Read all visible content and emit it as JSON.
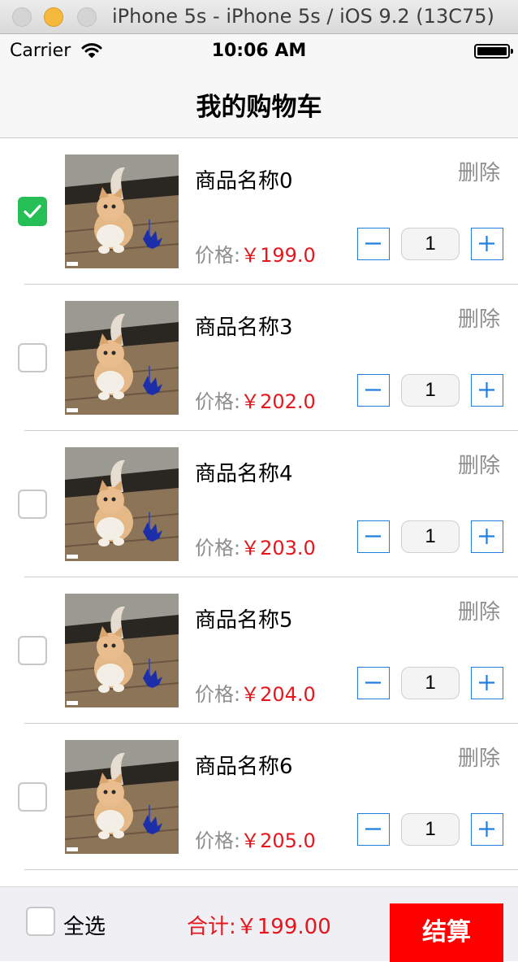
{
  "window": {
    "title": "iPhone 5s - iPhone 5s / iOS 9.2 (13C75)"
  },
  "status_bar": {
    "carrier": "Carrier",
    "time": "10:06 AM"
  },
  "nav": {
    "title": "我的购物车"
  },
  "cart": {
    "delete_label": "删除",
    "price_label": "价格:",
    "items": [
      {
        "name": "商品名称0",
        "price": "￥199.0",
        "quantity": "1",
        "checked": true
      },
      {
        "name": "商品名称3",
        "price": "￥202.0",
        "quantity": "1",
        "checked": false
      },
      {
        "name": "商品名称4",
        "price": "￥203.0",
        "quantity": "1",
        "checked": false
      },
      {
        "name": "商品名称5",
        "price": "￥204.0",
        "quantity": "1",
        "checked": false
      },
      {
        "name": "商品名称6",
        "price": "￥205.0",
        "quantity": "1",
        "checked": false
      }
    ]
  },
  "footer": {
    "select_all_label": "全选",
    "select_all_checked": false,
    "total": "合计:￥199.00",
    "checkout_label": "结算"
  },
  "colors": {
    "price": "#e5161c",
    "checkbox_checked": "#26bf55",
    "stepper_border": "#1f7ede",
    "checkout_button": "#ff0000"
  }
}
